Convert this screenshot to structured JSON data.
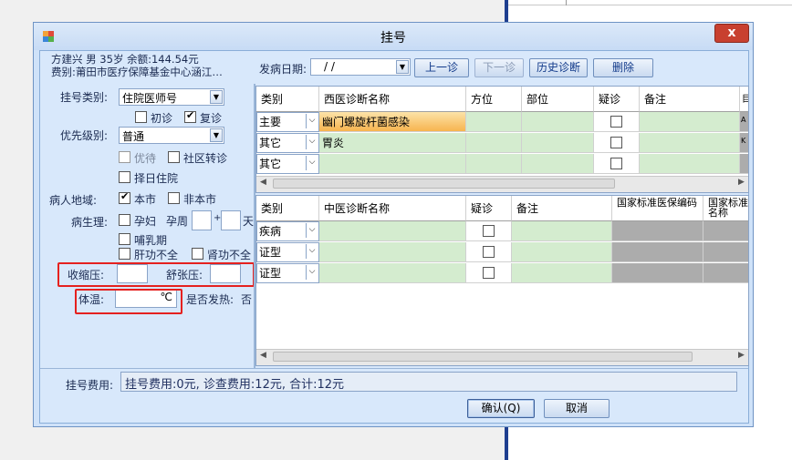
{
  "dialog": {
    "title": "挂号",
    "close_label": "x"
  },
  "patient": {
    "line1": "方建兴 男 35岁 余额:144.54元",
    "line2": "费别:莆田市医疗保障基金中心涵江…"
  },
  "toolbar": {
    "date_label": "发病日期:",
    "date_value": "  /   /",
    "prev_visit": "上一诊",
    "next_visit": "下一诊",
    "history": "历史诊断",
    "delete": "删除"
  },
  "left": {
    "reg_type_label": "挂号类别:",
    "reg_type_value": "住院医师号",
    "first_visit": "初诊",
    "return_visit": "复诊",
    "priority_label": "优先级别:",
    "priority_value": "普通",
    "priority_opt": "优待",
    "community_transfer": "社区转诊",
    "select_day": "择日住院",
    "region_label": "病人地域:",
    "local": "本市",
    "nonlocal": "非本市",
    "physio_label": "病生理:",
    "pregnant": "孕妇",
    "gest_week": "孕周",
    "plus": "+",
    "day": "天",
    "lactation": "哺乳期",
    "liver": "肝功不全",
    "kidney": "肾功不全",
    "systolic": "收缩压:",
    "diastolic": "舒张压:",
    "temp_label": "体温:",
    "temp_unit": "℃",
    "fever_label": "是否发热:",
    "fever_value": "否"
  },
  "western_grid": {
    "headers": [
      "类别",
      "西医诊断名称",
      "方位",
      "部位",
      "疑诊",
      "备注",
      "目录"
    ],
    "rows": [
      {
        "cat": "主要",
        "name": "幽门螺旋杆菌感染",
        "extra": "A"
      },
      {
        "cat": "其它",
        "name": "胃炎",
        "extra": "K"
      },
      {
        "cat": "其它",
        "name": "",
        "extra": ""
      }
    ]
  },
  "tcm_grid": {
    "headers": [
      "类别",
      "中医诊断名称",
      "疑诊",
      "备注",
      "国家标准医保编码",
      "国家标准名称"
    ],
    "rows": [
      {
        "cat": "疾病"
      },
      {
        "cat": "证型"
      },
      {
        "cat": "证型"
      }
    ]
  },
  "footer": {
    "fee_label": "挂号费用:",
    "fee_value": "挂号费用:0元, 诊查费用:12元, 合计:12元",
    "confirm": "确认(Q)",
    "cancel": "取消"
  },
  "colors": {
    "accent_red": "#e5211f",
    "grid_green": "#d4eccf",
    "selection_orange": "#f7b44f",
    "close_red": "#c8402f"
  }
}
